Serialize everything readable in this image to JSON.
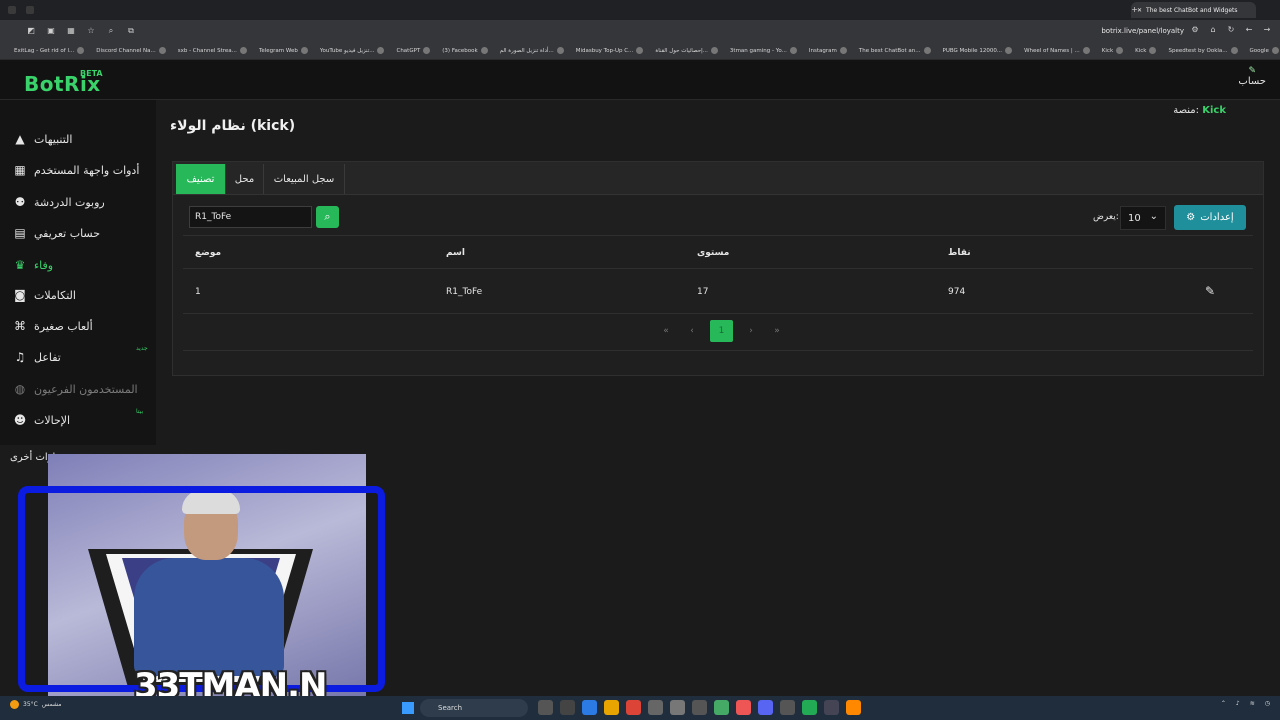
{
  "browser": {
    "tab_title": "The best ChatBot and Widgets",
    "url": "botrix.live/panel/loyalty",
    "bookmarks": [
      "ExitLag - Get rid of l...",
      "Discord Channel Na...",
      "sxb - Channel Strea...",
      "Telegram Web",
      "YouTube تنزيل فيديو...",
      "ChatGPT",
      "(3) Facebook",
      "أداة تنزيل الصورة الم...",
      "Midasbuy Top-Up C...",
      "إحصائيات حول القناة...",
      "3tman gaming - Yo...",
      "Instagram",
      "The best ChatBot an...",
      "PUBG Mobile 12000...",
      "Wheel of Names | ...",
      "Kick",
      "Kick",
      "Speedtest by Ookla...",
      "Google"
    ]
  },
  "header": {
    "logo": "BotRix",
    "beta": "BETA",
    "account_label": "حساب"
  },
  "sidebar": {
    "platform_label": "منصة:",
    "platform_name": "Kick",
    "items": [
      {
        "label": "التنبيهات",
        "icon": "warning-icon"
      },
      {
        "label": "أدوات واجهة المستخدم",
        "icon": "widgets-icon"
      },
      {
        "label": "روبوت الدردشة",
        "icon": "robot-icon"
      },
      {
        "label": "حساب تعريفي",
        "icon": "id-card-icon"
      },
      {
        "label": "وفاء",
        "icon": "trophy-icon"
      },
      {
        "label": "التكاملات",
        "icon": "integrations-icon"
      },
      {
        "label": "ألعاب صغيرة",
        "icon": "gamepad-icon"
      },
      {
        "label": "تفاعل",
        "icon": "music-icon",
        "tag": "جديد"
      },
      {
        "label": "المستخدمون الفرعيون",
        "icon": "subuser-icon"
      },
      {
        "label": "الإحالات",
        "icon": "users-icon",
        "tag": "بيتا"
      }
    ],
    "others_label": "خيارات أخرى"
  },
  "main": {
    "title": "نظام الولاء (kick)",
    "tabs": [
      "تصنيف",
      "محل",
      "سجل المبيعات"
    ],
    "search_value": "R1_ToFe",
    "show_label": "يعرض:",
    "page_size": "10",
    "settings_label": "إعدادات",
    "columns": [
      "موضع",
      "اسم",
      "مستوى",
      "نقاط"
    ],
    "rows": [
      {
        "position": "1",
        "name": "R1_ToFe",
        "level": "17",
        "points": "974"
      }
    ],
    "current_page": "1"
  },
  "overlay": {
    "streamer_name": "33TMAN.N"
  },
  "taskbar": {
    "temperature": "35°C",
    "weather": "مشمس",
    "search_placeholder": "Search"
  }
}
